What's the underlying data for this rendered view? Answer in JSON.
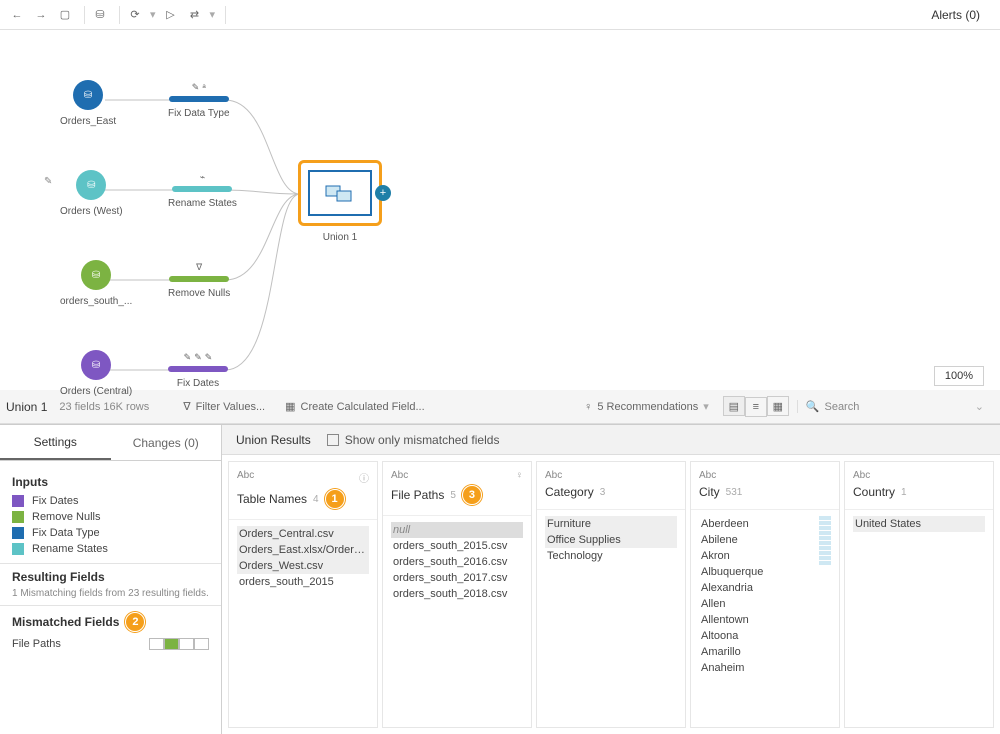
{
  "toolbar": {
    "alerts": "Alerts (0)"
  },
  "canvas": {
    "zoom": "100%",
    "nodes": {
      "east": "Orders_East",
      "west": "Orders (West)",
      "south": "orders_south_...",
      "central": "Orders (Central)"
    },
    "steps": {
      "fix_data_type": "Fix Data Type",
      "rename_states": "Rename States",
      "remove_nulls": "Remove Nulls",
      "fix_dates": "Fix Dates"
    },
    "union": "Union 1"
  },
  "panel": {
    "step_name": "Union 1",
    "meta": "23 fields  16K rows",
    "filter": "Filter Values...",
    "calc": "Create Calculated Field...",
    "recs": "5 Recommendations",
    "search_ph": "Search"
  },
  "left": {
    "tabs": {
      "settings": "Settings",
      "changes": "Changes (0)"
    },
    "inputs_hdr": "Inputs",
    "inputs": [
      "Fix Dates",
      "Remove Nulls",
      "Fix Data Type",
      "Rename States"
    ],
    "input_colors": [
      "#7e57c2",
      "#7cb342",
      "#1f6db0",
      "#5dc3c6"
    ],
    "resulting_hdr": "Resulting Fields",
    "resulting_sub": "1 Mismatching fields from 23 resulting fields.",
    "mismatch_hdr": "Mismatched Fields",
    "mismatch_field": "File Paths"
  },
  "results": {
    "title": "Union Results",
    "show_only": "Show only mismatched fields"
  },
  "cols": [
    {
      "type": "Abc",
      "name": "Table Names",
      "count": "4",
      "values": [
        {
          "t": "Orders_Central.csv",
          "shade": true
        },
        {
          "t": "Orders_East.xlsx/Orders_E...",
          "shade": true
        },
        {
          "t": "Orders_West.csv",
          "shade": true
        },
        {
          "t": "orders_south_2015",
          "shade": false
        }
      ],
      "callout": "1",
      "icon": "info"
    },
    {
      "type": "Abc",
      "name": "File Paths",
      "count": "5",
      "values": [
        {
          "t": "null",
          "null": true
        },
        {
          "t": "orders_south_2015.csv"
        },
        {
          "t": "orders_south_2016.csv"
        },
        {
          "t": "orders_south_2017.csv"
        },
        {
          "t": "orders_south_2018.csv"
        }
      ],
      "callout": "3",
      "icon": "bulb"
    },
    {
      "type": "Abc",
      "name": "Category",
      "count": "3",
      "values": [
        {
          "t": "Furniture",
          "shade": true
        },
        {
          "t": "Office Supplies",
          "shade": true
        },
        {
          "t": "Technology"
        }
      ]
    },
    {
      "type": "Abc",
      "name": "City",
      "count": "531",
      "values": [
        {
          "t": "Aberdeen"
        },
        {
          "t": "Abilene"
        },
        {
          "t": "Akron"
        },
        {
          "t": "Albuquerque"
        },
        {
          "t": "Alexandria"
        },
        {
          "t": "Allen"
        },
        {
          "t": "Allentown"
        },
        {
          "t": "Altoona"
        },
        {
          "t": "Amarillo"
        },
        {
          "t": "Anaheim"
        }
      ],
      "hist": true
    },
    {
      "type": "Abc",
      "name": "Country",
      "count": "1",
      "values": [
        {
          "t": "United States",
          "shade": true
        }
      ]
    }
  ],
  "callouts": {
    "mismatch": "2"
  }
}
